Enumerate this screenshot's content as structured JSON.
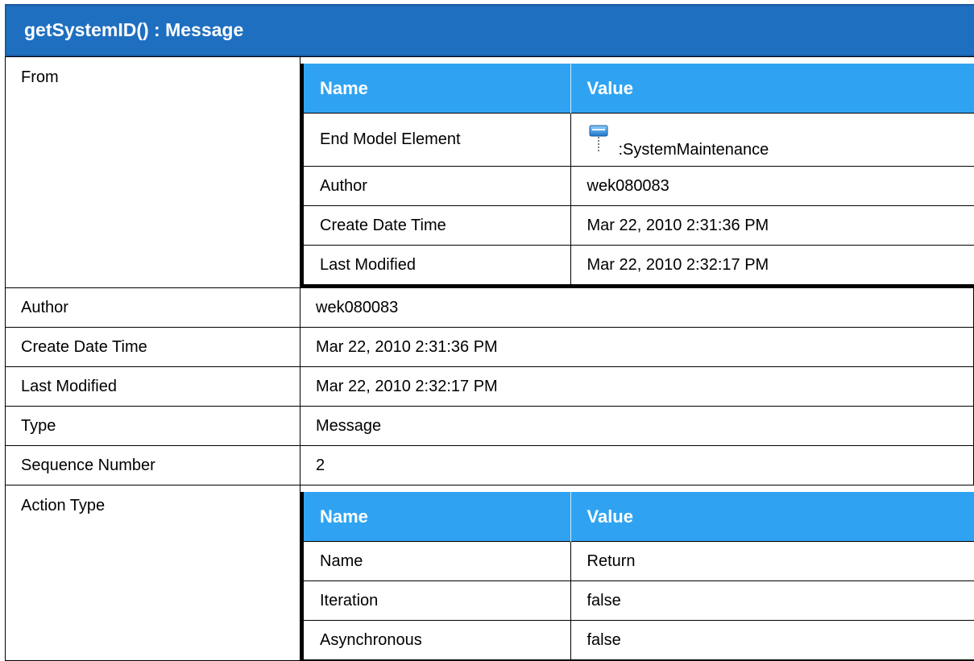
{
  "title": "getSystemID() : Message",
  "nested_header": {
    "name": "Name",
    "value": "Value"
  },
  "from": {
    "label": "From",
    "rows": [
      {
        "name": "End Model Element",
        "value": ":SystemMaintenance",
        "icon": "lifeline-icon"
      },
      {
        "name": "Author",
        "value": "wek080083"
      },
      {
        "name": "Create Date Time",
        "value": "Mar 22, 2010 2:31:36 PM"
      },
      {
        "name": "Last Modified",
        "value": "Mar 22, 2010 2:32:17 PM"
      }
    ]
  },
  "properties": [
    {
      "label": "Author",
      "value": "wek080083"
    },
    {
      "label": "Create Date Time",
      "value": "Mar 22, 2010 2:31:36 PM"
    },
    {
      "label": "Last Modified",
      "value": "Mar 22, 2010 2:32:17 PM"
    },
    {
      "label": "Type",
      "value": "Message"
    },
    {
      "label": "Sequence Number",
      "value": "2"
    }
  ],
  "action_type": {
    "label": "Action Type",
    "rows": [
      {
        "name": "Name",
        "value": "Return"
      },
      {
        "name": "Iteration",
        "value": "false"
      },
      {
        "name": "Asynchronous",
        "value": "false"
      }
    ]
  },
  "colors": {
    "header_bg": "#1f6fc0",
    "nested_header_bg": "#2fa3f2"
  }
}
